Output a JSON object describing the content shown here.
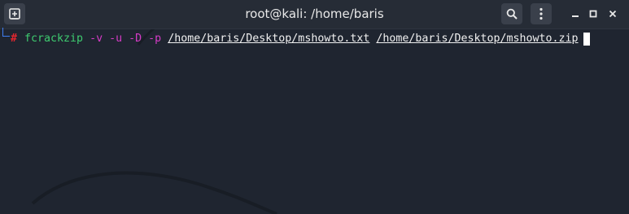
{
  "window": {
    "title": "root@kali: /home/baris",
    "colors": {
      "background": "#1f2530",
      "titlebar": "#262c36",
      "prompt_corner": "#3f7ff2",
      "prompt_hash": "#e1262e",
      "command": "#3ecb6f",
      "options": "#d63bc7",
      "path": "#f0f0f0"
    }
  },
  "titlebar": {
    "new_tab_icon": "new-tab-icon",
    "search_icon": "search-icon",
    "menu_icon": "vertical-dots-icon",
    "minimize_icon": "minimize-icon",
    "maximize_icon": "maximize-icon",
    "close_icon": "close-icon"
  },
  "terminal": {
    "prompt_symbol": "#",
    "command": "fcrackzip",
    "options": [
      "-v",
      "-u",
      "-D",
      "-p"
    ],
    "args": [
      "/home/baris/Desktop/mshowto.txt",
      "/home/baris/Desktop/mshowto.zip"
    ]
  }
}
